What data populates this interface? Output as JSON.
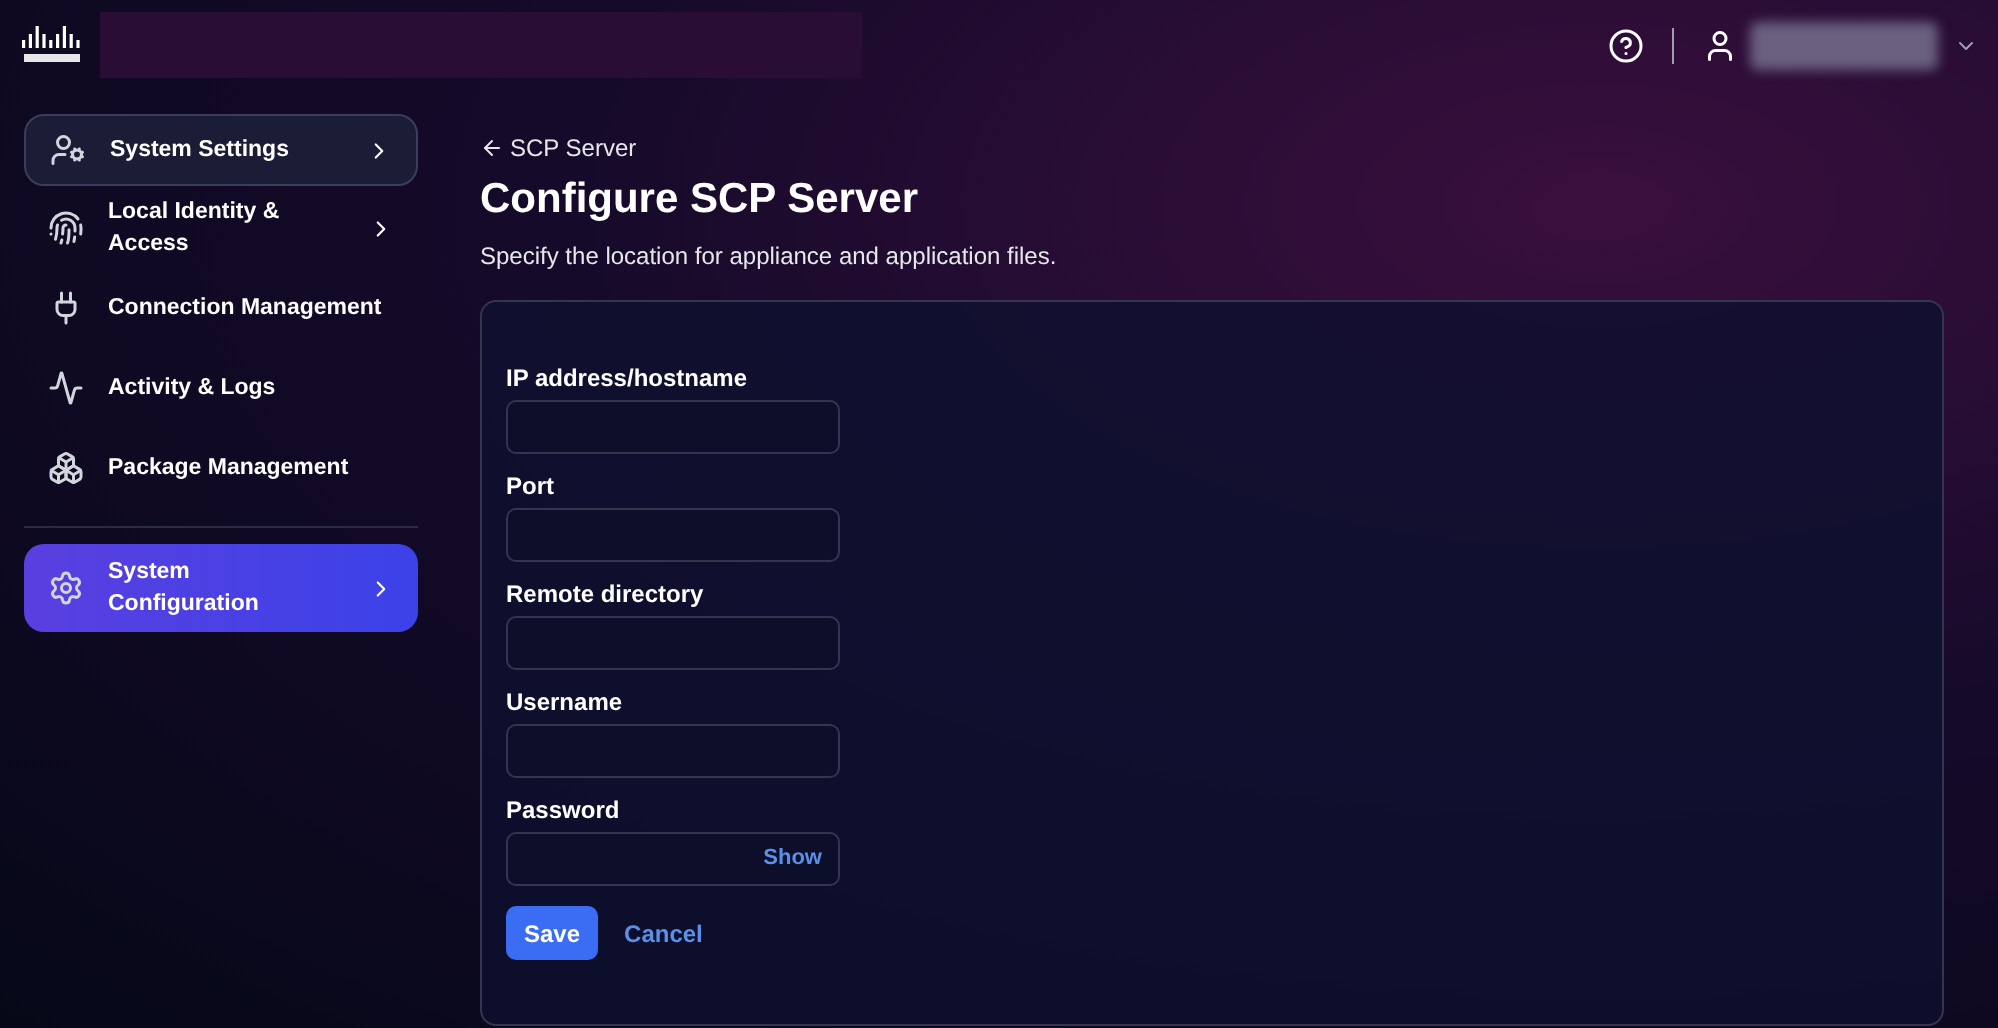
{
  "sidebar": {
    "items": [
      {
        "label": "System Settings",
        "selected": false,
        "outlined": true,
        "has_submenu": true
      },
      {
        "label": "Local Identity & Access",
        "selected": false,
        "outlined": false,
        "has_submenu": true
      },
      {
        "label": "Connection Management",
        "selected": false,
        "outlined": false,
        "has_submenu": false
      },
      {
        "label": "Activity & Logs",
        "selected": false,
        "outlined": false,
        "has_submenu": false
      },
      {
        "label": "Package Management",
        "selected": false,
        "outlined": false,
        "has_submenu": false
      },
      {
        "label": "System Configuration",
        "selected": true,
        "outlined": false,
        "has_submenu": true
      }
    ]
  },
  "back_link": "SCP Server",
  "title": "Configure SCP Server",
  "subtitle": "Specify the location for appliance and application files.",
  "form": {
    "fields": [
      {
        "label": "IP address/hostname",
        "kind": "text"
      },
      {
        "label": "Port",
        "kind": "text"
      },
      {
        "label": "Remote directory",
        "kind": "text"
      },
      {
        "label": "Username",
        "kind": "text"
      },
      {
        "label": "Password",
        "kind": "password",
        "toggle": "Show"
      }
    ],
    "buttons": [
      {
        "label": "Save",
        "kind": "primary"
      },
      {
        "label": "Cancel",
        "kind": "link"
      }
    ]
  }
}
